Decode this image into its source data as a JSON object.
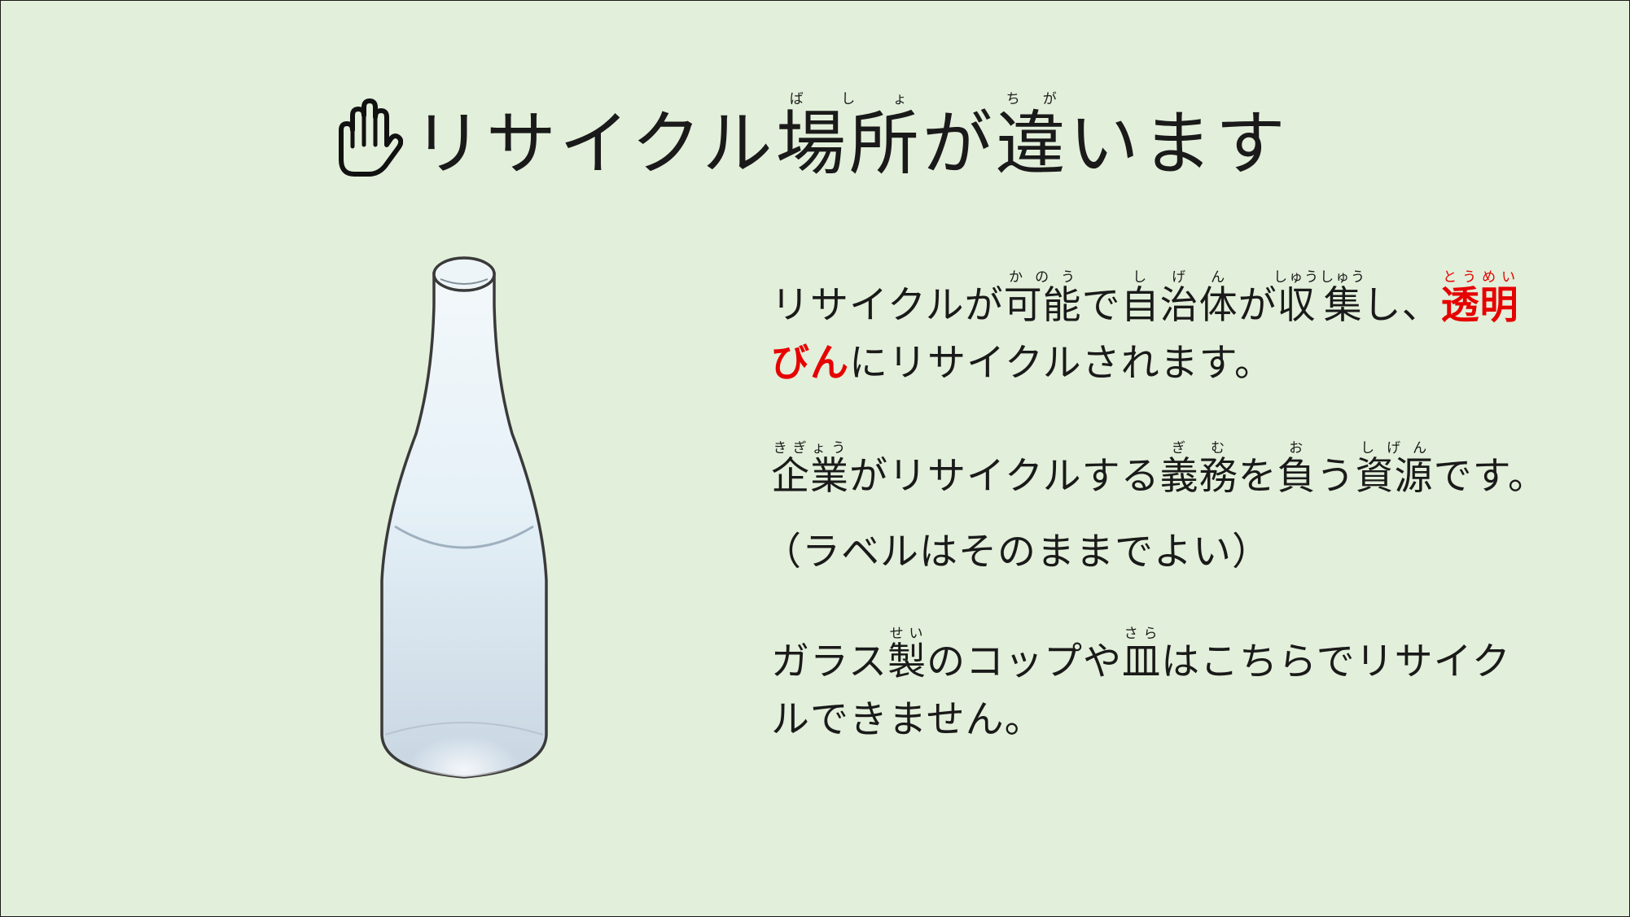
{
  "slide": {
    "background": "#e2efda",
    "title": {
      "icon": "raised-hand-icon",
      "text_a": "リサイクル",
      "ruby1_base": "場所",
      "ruby1_reading": "ばしょ",
      "text_b": "が",
      "ruby2_base": "違",
      "ruby2_reading": "ちが",
      "text_c": "います"
    },
    "image": {
      "icon": "glass-bottle-icon"
    },
    "body": {
      "accent_color": "#e60000",
      "line1": {
        "t1": "リサイクルが",
        "r1_base": "可能",
        "r1_reading": "かのう",
        "t2": "で",
        "r2_base": "自治体",
        "r2_reading": "しげん",
        "t3": "が",
        "r3_base": "収集",
        "r3_reading": "しゅうしゅう",
        "t4": "し、",
        "accent_base": "透明",
        "accent_reading": "とうめい"
      },
      "line2": {
        "accent": "びん",
        "t1": "にリサイクルされます。"
      },
      "line3": {
        "r1_base": "企業",
        "r1_reading": "きぎょう",
        "t1": "がリサイクルする",
        "r2_base": "義務",
        "r2_reading": "ぎむ",
        "t2": "を",
        "r3_base": "負",
        "r3_reading": "お",
        "t3": "う",
        "r4_base": "資源",
        "r4_reading": "しげん",
        "t4": "です。"
      },
      "line4": {
        "t1": "（ラベルはそのままでよい）"
      },
      "line5": {
        "t1": "ガラス",
        "r1_base": "製",
        "r1_reading": "せい",
        "t2": "のコップや",
        "r2_base": "皿",
        "r2_reading": "さら",
        "t3": "はこちらでリサイク"
      },
      "line6": {
        "t1": "ルできません。"
      }
    }
  }
}
